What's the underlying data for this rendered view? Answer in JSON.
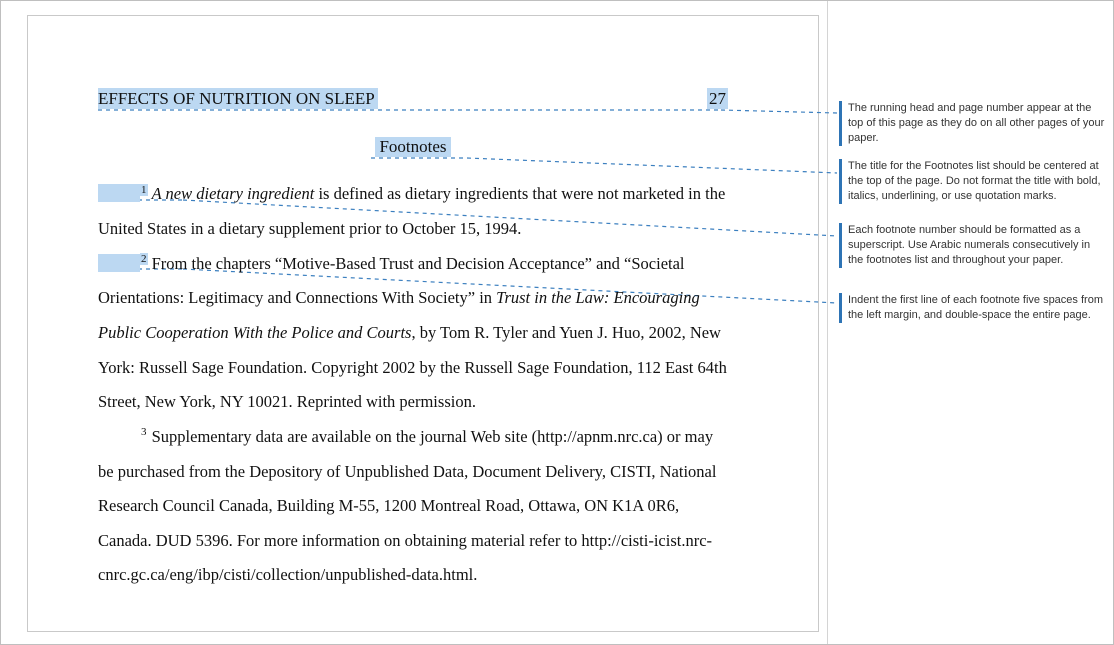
{
  "header": {
    "running_head": "EFFECTS OF NUTRITION ON SLEEP",
    "page_number": "27"
  },
  "section_title": "Footnotes",
  "footnotes": [
    {
      "num": "1",
      "highlighted": true,
      "pre_italic": "A new dietary ingredient",
      "rest": " is defined as dietary ingredients that were not marketed in the United States in a dietary supplement prior to October 15, 1994."
    },
    {
      "num": "2",
      "highlighted": true,
      "text_before_italic": "From the chapters “Motive-Based Trust and Decision Acceptance” and “Societal Orientations: Legitimacy and Connections With Society” in ",
      "italic": "Trust in the Law: Encouraging Public Cooperation With the Police and Courts",
      "text_after_italic": ", by Tom R. Tyler and Yuen J. Huo, 2002, New York: Russell Sage Foundation. Copyright 2002 by the Russell Sage Foundation, 112 East 64th Street, New York, NY 10021. Reprinted with permission."
    },
    {
      "num": "3",
      "highlighted": false,
      "plain": "Supplementary data are available on the journal Web site (http://apnm.nrc.ca) or may be purchased from the Depository of Unpublished Data, Document Delivery, CISTI, National Research Council Canada, Building M-55, 1200 Montreal Road, Ottawa, ON K1A 0R6, Canada. DUD 5396. For more information on obtaining material refer to http://cisti-icist.nrc-cnrc.gc.ca/eng/ibp/cisti/collection/unpublished-data.html."
    }
  ],
  "annotations": {
    "n1": "The running head and page number appear at the top of this page as they do on all other pages of your paper.",
    "n2": "The title for the Footnotes list should be centered at the top of the page. Do not format the title with bold, italics, underlining, or use quotation marks.",
    "n3": "Each footnote number should be formatted as a superscript. Use Arabic numerals consecutively in the footnotes list and throughout your paper.",
    "n4": "Indent the first line of each footnote five spaces from the left margin, and double-space the entire page."
  },
  "colors": {
    "highlight": "#bcd8f2",
    "callout_stroke": "#3b7fbf",
    "note_border": "#2e74b5"
  }
}
